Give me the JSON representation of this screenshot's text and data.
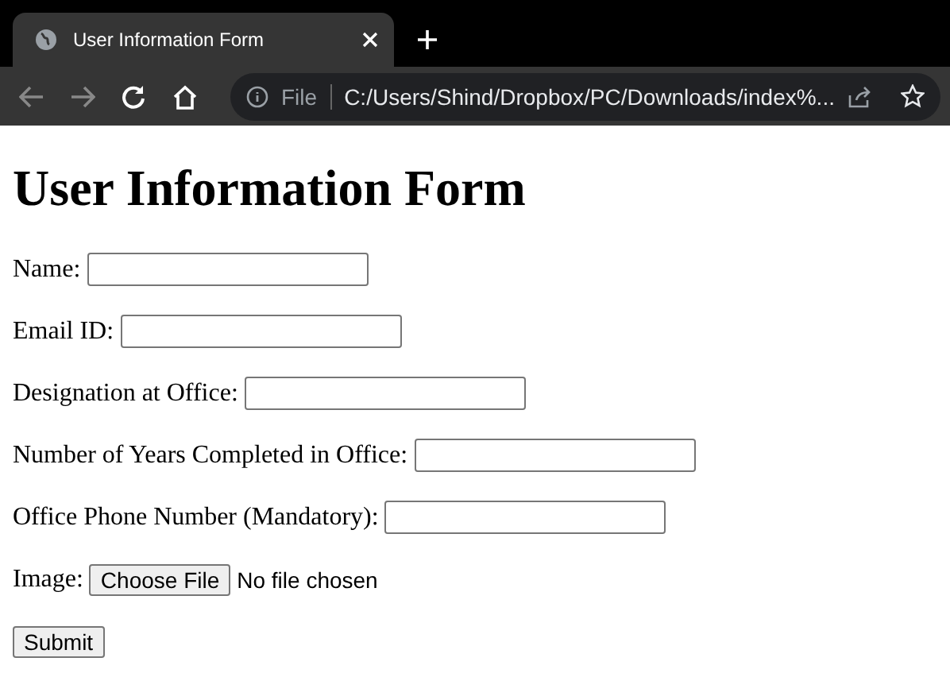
{
  "browser": {
    "tab_title": "User Information Form",
    "address_scheme": "File",
    "address": "C:/Users/Shind/Dropbox/PC/Downloads/index%..."
  },
  "form": {
    "title": "User Information Form",
    "fields": [
      {
        "kind": "text",
        "label": "Name:"
      },
      {
        "kind": "text",
        "label": "Email ID:"
      },
      {
        "kind": "text",
        "label": "Designation at Office:"
      },
      {
        "kind": "text",
        "label": "Number of Years Completed in Office:"
      },
      {
        "kind": "text",
        "label": "Office Phone Number (Mandatory):"
      },
      {
        "kind": "file",
        "label": "Image:",
        "button": "Choose File",
        "status": "No file chosen"
      }
    ],
    "submit": "Submit"
  }
}
